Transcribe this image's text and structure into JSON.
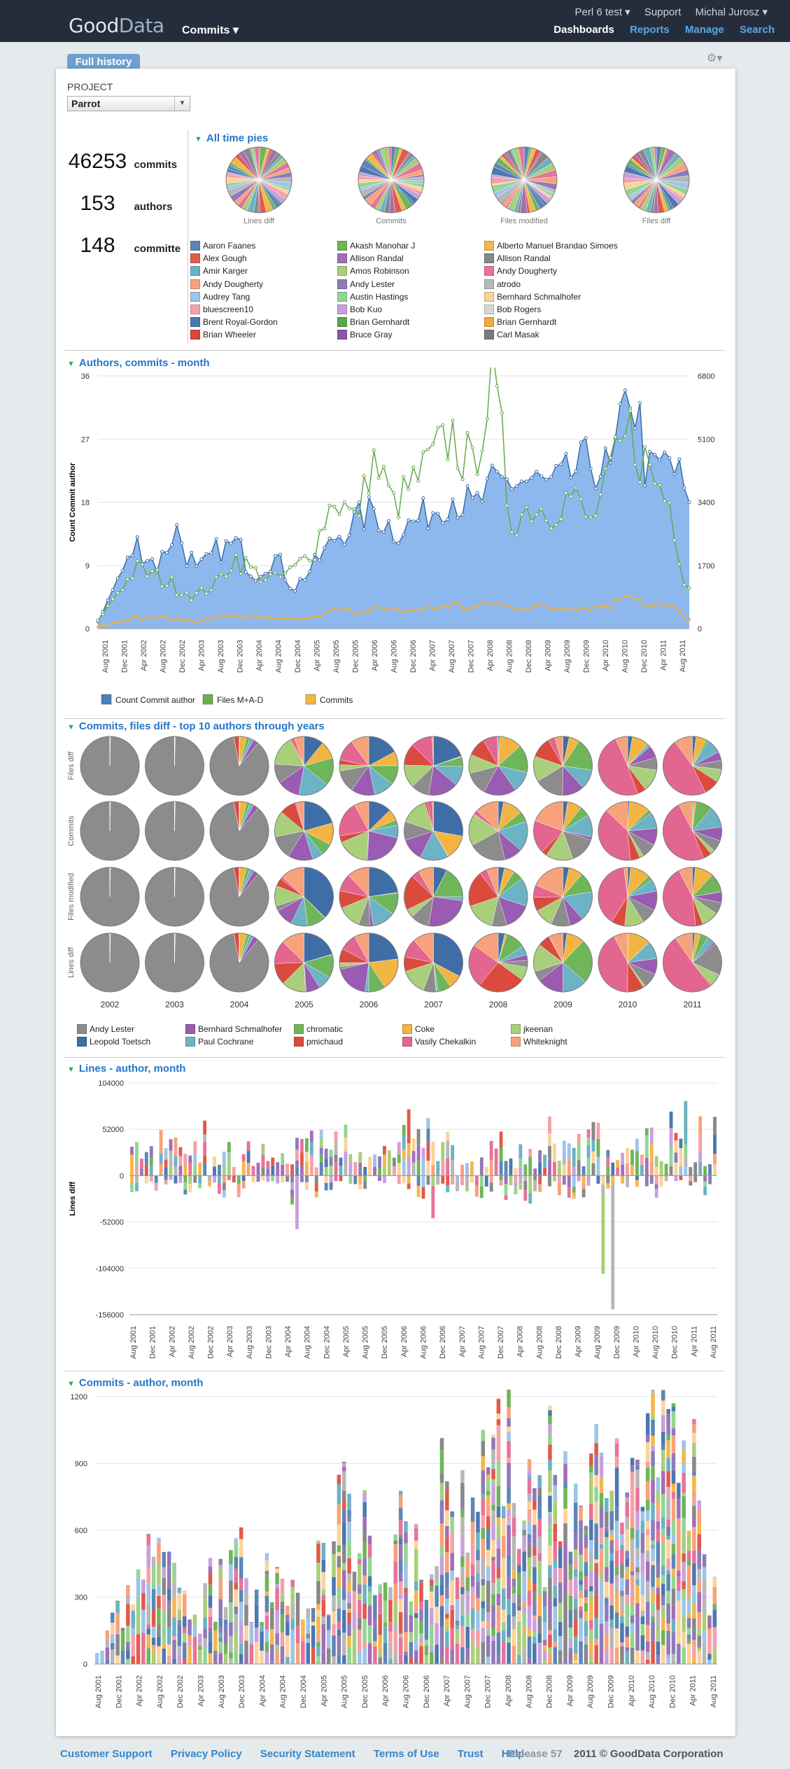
{
  "header": {
    "logo_good": "Good",
    "logo_data": "Data",
    "project_menu": "Commits ▾",
    "top_links": [
      "Perl 6 test ▾",
      "Support",
      "Michal Jurosz ▾"
    ],
    "nav": [
      "Dashboards",
      "Reports",
      "Manage",
      "Search"
    ],
    "active_nav": "Dashboards"
  },
  "tab": {
    "label": "Full history",
    "gear": "⚙▾"
  },
  "filter": {
    "label": "PROJECT",
    "value": "Parrot"
  },
  "kpis": [
    {
      "value": "46253",
      "label": "commits"
    },
    {
      "value": "153",
      "label": "authors"
    },
    {
      "value": "148",
      "label": "committe"
    }
  ],
  "icons": {
    "section_toggle": "triangle-down-icon",
    "settings": "gear-icon",
    "dropdown": "chevron-down-icon"
  },
  "section1": {
    "title": "All time pies",
    "pie_captions": [
      "Lines diff",
      "Commits",
      "Files modified",
      "Files diff"
    ],
    "legend": [
      [
        "Aaron Faanes",
        "#5e85b6"
      ],
      [
        "Akash Manohar J",
        "#6eb55b"
      ],
      [
        "Alberto Manuel Brandao Simoes",
        "#f4b74b"
      ],
      [
        "Alex Gough",
        "#e15a4a"
      ],
      [
        "Allison Randal",
        "#a16fb6"
      ],
      [
        "Allison Randal",
        "#888888"
      ],
      [
        "Amir Karger",
        "#6cb2c4"
      ],
      [
        "Amos Robinson",
        "#a9cf7a"
      ],
      [
        "Andy Dougherty",
        "#e8729a"
      ],
      [
        "Andy Dougherty",
        "#f7a27b"
      ],
      [
        "Andy Lester",
        "#8e7bb8"
      ],
      [
        "atrodo",
        "#b7b7b7"
      ],
      [
        "Audrey Tang",
        "#9ec4e8"
      ],
      [
        "Austin Hastings",
        "#93d593"
      ],
      [
        "Bernhard Schmalhofer",
        "#fbd39a"
      ],
      [
        "bluescreen10",
        "#f5a0a8"
      ],
      [
        "Bob Kuo",
        "#c9a0dc"
      ],
      [
        "Bob Rogers",
        "#d6d6d6"
      ],
      [
        "Brent Royal-Gordon",
        "#4d78ae"
      ],
      [
        "Brian Gernhardt",
        "#5aa64c"
      ],
      [
        "Brian Gernhardt",
        "#f0a93c"
      ],
      [
        "Brian Wheeler",
        "#d9473a"
      ],
      [
        "Bruce Gray",
        "#8e56a8"
      ],
      [
        "Carl Masak",
        "#7a7a7a"
      ]
    ]
  },
  "section2": {
    "title": "Authors, commits - month",
    "legend": [
      [
        "Count Commit author",
        "#4a7ec2"
      ],
      [
        "Files M+A-D",
        "#6ab04c"
      ],
      [
        "Commits",
        "#f5b53f"
      ]
    ],
    "y_left_ticks": [
      "36",
      "27",
      "18",
      "9",
      "0"
    ],
    "y_right_ticks": [
      "6800",
      "5100",
      "3400",
      "1700",
      "0"
    ],
    "ylabel": "Count Commit author"
  },
  "section3": {
    "title": "Commits, files diff - top 10 authors through years",
    "row_labels": [
      "Files diff",
      "Commits",
      "Files modified",
      "Lines diff"
    ],
    "years": [
      "2002",
      "2003",
      "2004",
      "2005",
      "2006",
      "2007",
      "2008",
      "2009",
      "2010",
      "2011"
    ],
    "legend": [
      [
        "Andy Lester",
        "#8c8c8c"
      ],
      [
        "Bernhard Schmalhofer",
        "#9a5bb3"
      ],
      [
        "chromatic",
        "#6fb65b"
      ],
      [
        "Coke",
        "#f2b443"
      ],
      [
        "jkeenan",
        "#a9cf7a"
      ],
      [
        "Leopold Toetsch",
        "#3f6ea7"
      ],
      [
        "Paul Cochrane",
        "#6cb3c5"
      ],
      [
        "pmichaud",
        "#da4b3d"
      ],
      [
        "Vasily Chekalkin",
        "#e2668f"
      ],
      [
        "Whiteknight",
        "#f7a27b"
      ]
    ]
  },
  "section4": {
    "title": "Lines - author, month",
    "ylabel": "Lines diff",
    "y_ticks": [
      "104000",
      "52000",
      "0",
      "-52000",
      "-104000",
      "-156000"
    ]
  },
  "section5": {
    "title": "Commits - author, month",
    "y_ticks": [
      "1200",
      "900",
      "600",
      "300",
      "0"
    ]
  },
  "month_labels": [
    "Aug 2001",
    "Dec 2001",
    "Apr 2002",
    "Aug 2002",
    "Dec 2002",
    "Apr 2003",
    "Aug 2003",
    "Dec 2003",
    "Apr 2004",
    "Aug 2004",
    "Dec 2004",
    "Apr 2005",
    "Aug 2005",
    "Dec 2005",
    "Apr 2006",
    "Aug 2006",
    "Dec 2006",
    "Apr 2007",
    "Aug 2007",
    "Dec 2007",
    "Apr 2008",
    "Aug 2008",
    "Dec 2008",
    "Apr 2009",
    "Aug 2009",
    "Dec 2009",
    "Apr 2010",
    "Aug 2010",
    "Dec 2010",
    "Apr 2011",
    "Aug 2011"
  ],
  "footer": {
    "links": [
      "Customer Support",
      "Privacy Policy",
      "Security Statement",
      "Terms of Use",
      "Trust",
      "Help"
    ],
    "release": "Release 57",
    "copyright": "2011 © GoodData Corporation"
  },
  "chart_data": [
    {
      "type": "line",
      "title": "Authors, commits - month",
      "ylabel": "Count Commit author",
      "ylim": [
        0,
        36
      ],
      "y2lim": [
        0,
        6800
      ],
      "x": [
        "Aug 2001",
        "Dec 2001",
        "Apr 2002",
        "Aug 2002",
        "Dec 2002",
        "Apr 2003",
        "Aug 2003",
        "Dec 2003",
        "Apr 2004",
        "Aug 2004",
        "Dec 2004",
        "Apr 2005",
        "Aug 2005",
        "Dec 2005",
        "Apr 2006",
        "Aug 2006",
        "Dec 2006",
        "Apr 2007",
        "Aug 2007",
        "Dec 2007",
        "Apr 2008",
        "Aug 2008",
        "Dec 2008",
        "Apr 2009",
        "Aug 2009",
        "Dec 2009",
        "Apr 2010",
        "Aug 2010",
        "Dec 2010",
        "Apr 2011",
        "Aug 2011"
      ],
      "series": [
        {
          "name": "Count Commit author",
          "axis": "left",
          "values": [
            1,
            7,
            12,
            9,
            14,
            8,
            11,
            12,
            8,
            10,
            6,
            9,
            13,
            15,
            17,
            14,
            15,
            17,
            19,
            17,
            20,
            21,
            21,
            20,
            22,
            24,
            22,
            35,
            22,
            24,
            18
          ]
        },
        {
          "name": "Files M+A-D",
          "axis": "right",
          "values": [
            200,
            1000,
            1600,
            1400,
            1100,
            900,
            1200,
            1900,
            1500,
            1300,
            1600,
            2200,
            3600,
            2900,
            4500,
            3300,
            3900,
            4600,
            5200,
            4200,
            6600,
            2900,
            3300,
            3200,
            3600,
            2800,
            4200,
            5300,
            4200,
            3400,
            1100
          ]
        },
        {
          "name": "Commits",
          "axis": "right",
          "values": [
            50,
            200,
            300,
            300,
            250,
            200,
            300,
            350,
            300,
            250,
            250,
            300,
            500,
            450,
            550,
            450,
            500,
            550,
            650,
            550,
            700,
            550,
            600,
            550,
            600,
            550,
            650,
            1000,
            600,
            600,
            250
          ]
        }
      ]
    },
    {
      "type": "bar",
      "title": "Lines - author, month",
      "ylabel": "Lines diff",
      "ylim": [
        -156000,
        104000
      ],
      "stacked": true,
      "note_values": "monthly stacked contributions per author"
    },
    {
      "type": "bar",
      "title": "Commits - author, month",
      "ylim": [
        0,
        1200
      ],
      "stacked": true
    }
  ]
}
